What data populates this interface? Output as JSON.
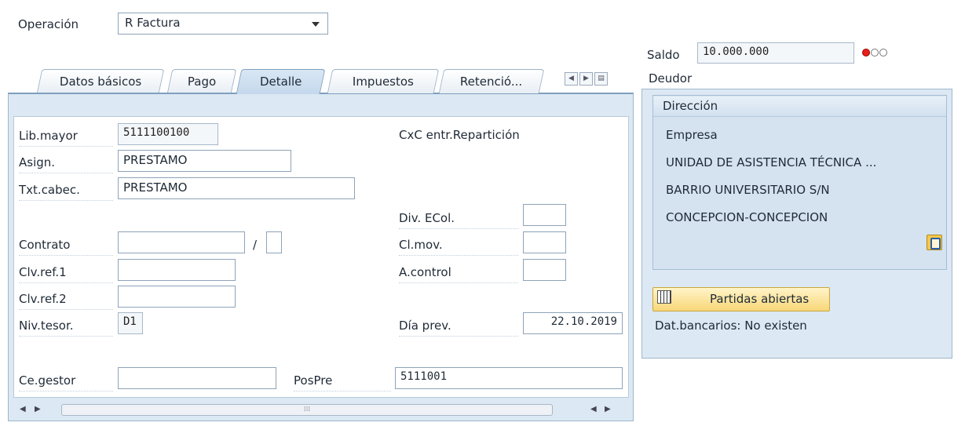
{
  "operation": {
    "label": "Operación",
    "value": "R Factura"
  },
  "saldo": {
    "label": "Saldo",
    "value": "10.000.000"
  },
  "tabs": [
    {
      "label": "Datos básicos"
    },
    {
      "label": "Pago"
    },
    {
      "label": "Detalle",
      "active": true
    },
    {
      "label": "Impuestos"
    },
    {
      "label": "Retenció..."
    }
  ],
  "detalle": {
    "lib_mayor": {
      "label": "Lib.mayor",
      "value": "5111100100"
    },
    "asign": {
      "label": "Asign.",
      "value": "PRESTAMO"
    },
    "txt_cabec": {
      "label": "Txt.cabec.",
      "value": "PRESTAMO"
    },
    "contrato": {
      "label": "Contrato",
      "value": "",
      "separator": "/"
    },
    "clv_ref1": {
      "label": "Clv.ref.1",
      "value": ""
    },
    "clv_ref2": {
      "label": "Clv.ref.2",
      "value": ""
    },
    "niv_tesor": {
      "label": "Niv.tesor.",
      "value": "D1"
    },
    "ce_gestor": {
      "label": "Ce.gestor",
      "value": ""
    },
    "pospre": {
      "label": "PosPre",
      "value": "5111001"
    },
    "cxc_reparticion": {
      "label": "CxC entr.Repartición"
    },
    "div_ecol": {
      "label": "Div. ECol.",
      "value": ""
    },
    "cl_mov": {
      "label": "Cl.mov.",
      "value": ""
    },
    "a_control": {
      "label": "A.control",
      "value": ""
    },
    "dia_prev": {
      "label": "Día prev.",
      "value": "22.10.2019"
    }
  },
  "deudor": {
    "title": "Deudor",
    "direccion_title": "Dirección",
    "lines": [
      "Empresa",
      "UNIDAD DE ASISTENCIA TÉCNICA ...",
      "BARRIO UNIVERSITARIO S/N",
      "CONCEPCION-CONCEPCION"
    ],
    "partidas_button": "Partidas abiertas",
    "bank_info": "Dat.bancarios: No existen"
  },
  "status_colors": {
    "red": "#e8201a",
    "off": "#ffffff"
  }
}
